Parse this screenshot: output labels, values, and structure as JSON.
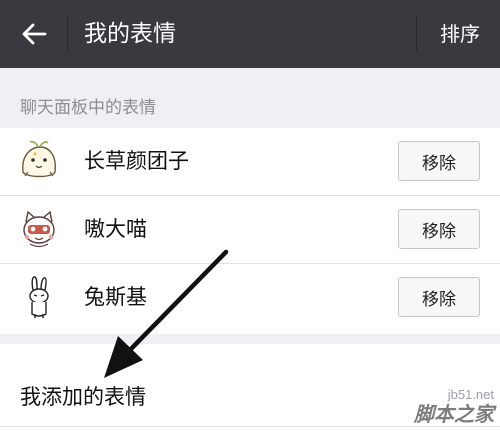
{
  "header": {
    "title": "我的表情",
    "sort_label": "排序",
    "back_icon": "arrow-left-icon",
    "background": "#393a3f"
  },
  "panel_section": {
    "label": "聊天面板中的表情",
    "items": [
      {
        "name": "长草颜团子",
        "action_label": "移除",
        "icon": "bun-sticker-icon"
      },
      {
        "name": "嗷大喵",
        "action_label": "移除",
        "icon": "cat-sticker-icon"
      },
      {
        "name": "兔斯基",
        "action_label": "移除",
        "icon": "rabbit-sticker-icon"
      }
    ]
  },
  "added_section": {
    "label": "我添加的表情"
  },
  "watermark": {
    "domain": "jb51.net",
    "brand": "脚本之家"
  }
}
